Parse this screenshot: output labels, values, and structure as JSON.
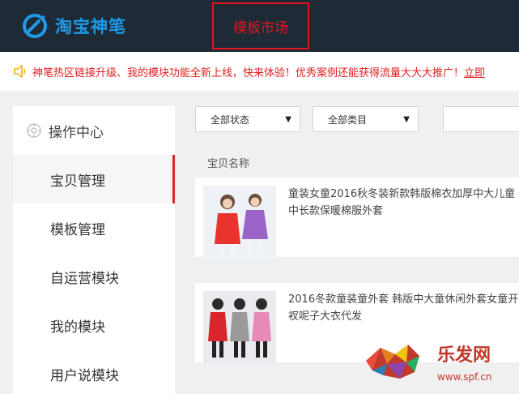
{
  "header": {
    "logo_text": "淘宝神笔",
    "market_tab": "模板市场"
  },
  "notice": {
    "icon": "speaker-icon",
    "text": "神笔热区链接升级、我的模块功能全新上线，快来体验！优秀案例还能获得流量大大大推广！",
    "link": "立即"
  },
  "sidebar": {
    "header": "操作中心",
    "items": [
      {
        "label": "宝贝管理",
        "active": true
      },
      {
        "label": "模板管理",
        "active": false
      },
      {
        "label": "自运营模块",
        "active": false
      },
      {
        "label": "我的模块",
        "active": false
      },
      {
        "label": "用户说模块",
        "active": false
      }
    ]
  },
  "filters": {
    "status": "全部状态",
    "category": "全部类目"
  },
  "table": {
    "column_header": "宝贝名称"
  },
  "products": [
    {
      "title": "童装女童2016秋冬装新款韩版棉衣加厚中大儿童中长款保暖棉服外套"
    },
    {
      "title": "2016冬款童装童外套 韩版中大童休闲外套女童开衩呢子大衣代发"
    }
  ],
  "watermark": {
    "brand": "乐发网",
    "url": "www.spf.cn"
  },
  "colors": {
    "topbar": "#1f2a37",
    "brand_blue": "#1e9be8",
    "accent_red": "#e0151c"
  }
}
